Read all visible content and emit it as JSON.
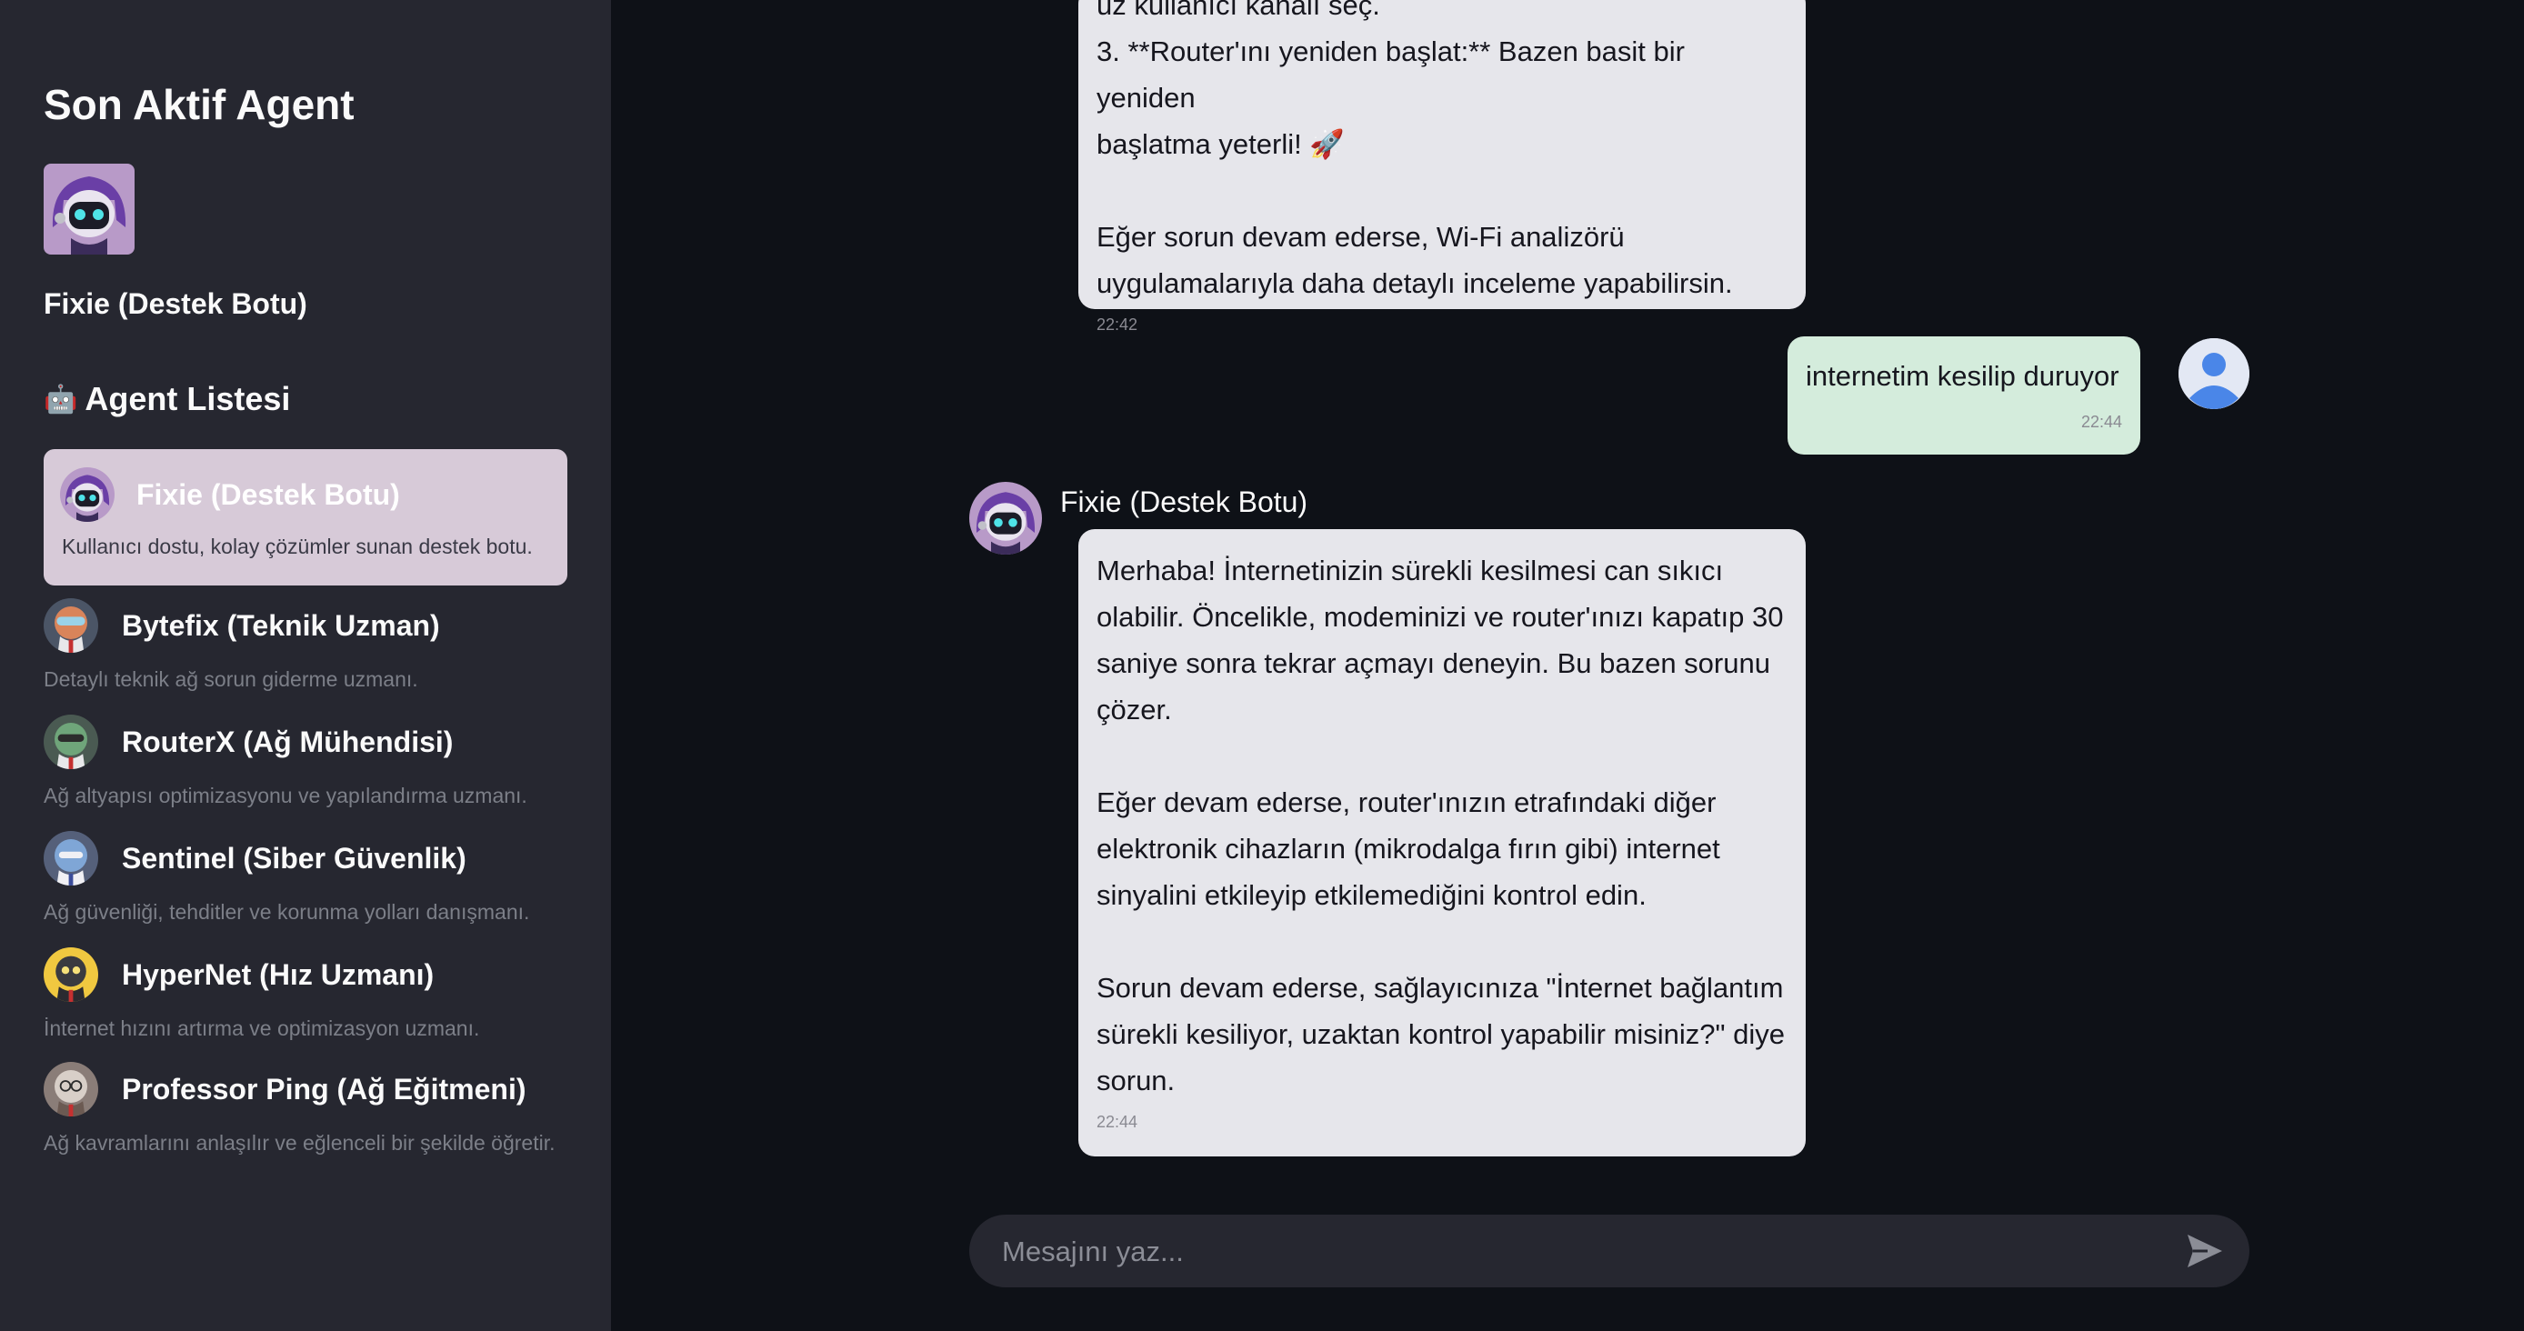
{
  "sidebar": {
    "title": "Son Aktif Agent",
    "active_agent_name": "Fixie (Destek Botu)",
    "list_title": "Agent Listesi",
    "robot_emoji": "🤖",
    "agents": [
      {
        "name": "Fixie (Destek Botu)",
        "desc": "Kullanıcı dostu, kolay çözümler sunan destek botu.",
        "active": true
      },
      {
        "name": "Bytefix (Teknik Uzman)",
        "desc": "Detaylı teknik ağ sorun giderme uzmanı."
      },
      {
        "name": "RouterX (Ağ Mühendisi)",
        "desc": "Ağ altyapısı optimizasyonu ve yapılandırma uzmanı."
      },
      {
        "name": "Sentinel (Siber Güvenlik)",
        "desc": "Ağ güvenliği, tehditler ve korunma yolları danışmanı."
      },
      {
        "name": "HyperNet (Hız Uzmanı)",
        "desc": "İnternet hızını artırma ve optimizasyon uzmanı."
      },
      {
        "name": "Professor Ping (Ağ Eğitmeni)",
        "desc": "Ağ kavramlarını anlaşılır ve eğlenceli bir şekilde öğretir."
      }
    ]
  },
  "chat": {
    "msg1": {
      "line0": "uz kullanıcı kanalı seç.",
      "line1": "3. **Router'ını yeniden başlat:** Bazen basit bir yeniden",
      "line2": "başlatma yeterli! 🚀",
      "line3": "Eğer sorun devam ederse, Wi-Fi analizörü",
      "line4": "uygulamalarıyla daha detaylı inceleme yapabilirsin.",
      "time": "22:42"
    },
    "user_msg": {
      "text": "internetim kesilip duruyor",
      "time": "22:44"
    },
    "bot_name": "Fixie (Destek Botu)",
    "msg2": {
      "l1": "Merhaba! İnternetinizin sürekli kesilmesi can sıkıcı",
      "l2": "olabilir. Öncelikle, modeminizi ve router'ınızı kapatıp 30",
      "l3": "saniye sonra tekrar açmayı deneyin. Bu bazen sorunu",
      "l4": "çözer.",
      "l5": "Eğer devam ederse, router'ınızın etrafındaki diğer",
      "l6": "elektronik cihazların (mikrodalga fırın gibi) internet",
      "l7": "sinyalini etkileyip etkilemediğini kontrol edin.",
      "l8": "Sorun devam ederse, sağlayıcınıza \"İnternet bağlantım",
      "l9": "sürekli kesiliyor, uzaktan kontrol yapabilir misiniz?\" diye",
      "l10": "sorun.",
      "time": "22:44"
    }
  },
  "input": {
    "placeholder": "Mesajını yaz..."
  },
  "colors": {
    "bg": "#0e1117",
    "sidebar": "#262730",
    "bot_bubble": "#e6e6eb",
    "user_bubble": "#d4ecdc",
    "active_item": "#d7cad8"
  },
  "icons": {
    "send": "send-icon",
    "user": "user-icon"
  }
}
